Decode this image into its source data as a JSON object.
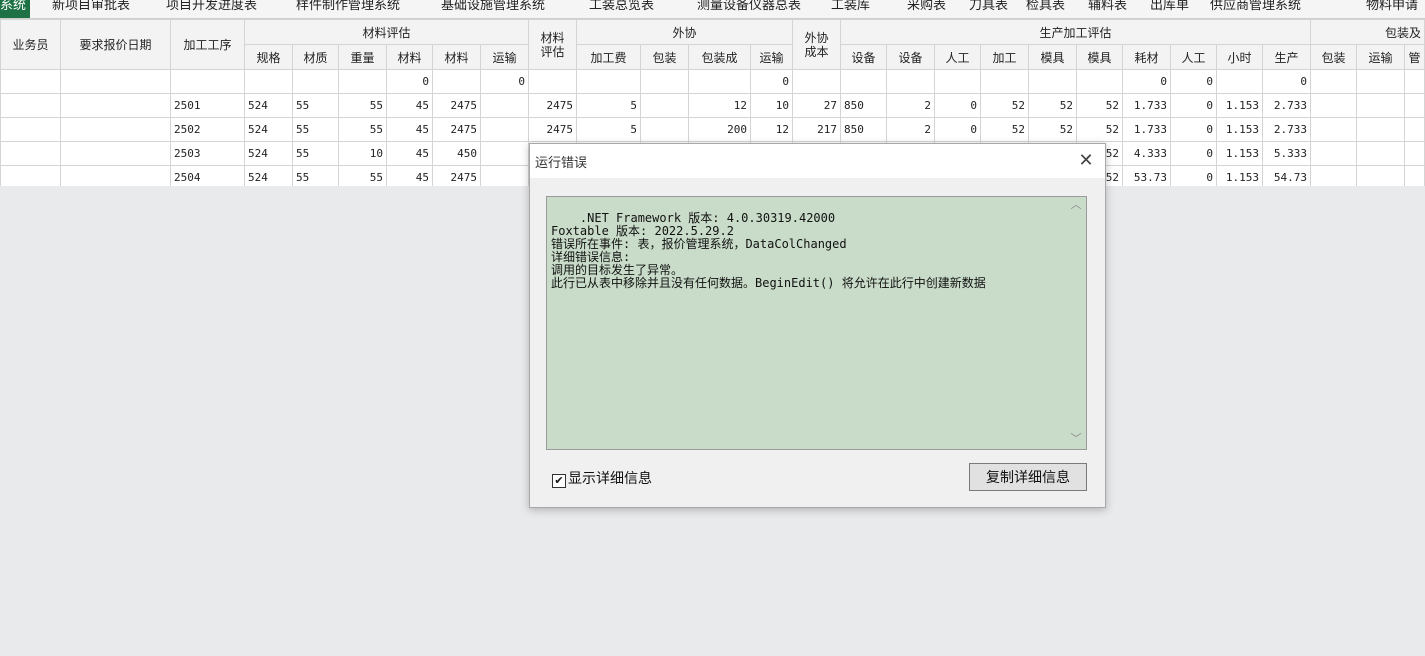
{
  "tabs": [
    "系统",
    "新项目审批表",
    "项目开发进度表",
    "样件制作管理系统",
    "基础设施管理系统",
    "工装总览表",
    "测量设备仪器总表",
    "工装库",
    "采购表",
    "刀具表",
    "检具表",
    "辅料表",
    "出库单",
    "供应商管理系统",
    "物料申请"
  ],
  "grid": {
    "header_top": {
      "salesman": "业务员",
      "quote_date": "要求报价日期",
      "process": "加工工序",
      "material_eval": "材料评估",
      "material_eval2": "材料\n评估",
      "outsource": "外协",
      "outsource_cost": "外协\n成本",
      "production_eval": "生产加工评估",
      "packaging": "包装及"
    },
    "header_sub": [
      "规格",
      "材质",
      "重量",
      "材料",
      "材料",
      "运输",
      "加工费",
      "包装",
      "包装成",
      "运输",
      "设备",
      "设备",
      "人工",
      "加工",
      "模具",
      "模具",
      "耗材",
      "人工",
      "小时",
      "生产",
      "包装",
      "运输",
      "管"
    ],
    "rows": [
      [
        "",
        "",
        "",
        "",
        "",
        "",
        "0",
        "",
        "0",
        "",
        "",
        "",
        "",
        "0",
        "",
        "",
        "",
        "",
        "",
        "",
        "",
        "0",
        "0",
        "",
        "0",
        "",
        "",
        ""
      ],
      [
        "",
        "",
        "2501",
        "524",
        "55",
        "55",
        "45",
        "2475",
        "",
        "2475",
        "5",
        "",
        "12",
        "10",
        "27",
        "850",
        "2",
        "0",
        "52",
        "52",
        "52",
        "1.733",
        "0",
        "1.153",
        "2.733",
        "",
        "",
        ""
      ],
      [
        "",
        "",
        "2502",
        "524",
        "55",
        "55",
        "45",
        "2475",
        "",
        "2475",
        "5",
        "",
        "200",
        "12",
        "217",
        "850",
        "2",
        "0",
        "52",
        "52",
        "52",
        "1.733",
        "0",
        "1.153",
        "2.733",
        "",
        "",
        ""
      ],
      [
        "",
        "",
        "2503",
        "524",
        "55",
        "10",
        "45",
        "450",
        "",
        "",
        "",
        "",
        "",
        "",
        "",
        "",
        "",
        "",
        "",
        "",
        "52",
        "4.333",
        "0",
        "1.153",
        "5.333",
        "",
        "",
        ""
      ],
      [
        "",
        "",
        "2504",
        "524",
        "55",
        "55",
        "45",
        "2475",
        "",
        "",
        "",
        "",
        "",
        "",
        "",
        "",
        "",
        "",
        "",
        "",
        "52",
        "53.73",
        "0",
        "1.153",
        "54.73",
        "",
        "",
        ""
      ]
    ]
  },
  "dialog": {
    "title": "运行错误",
    "message": ".NET Framework 版本: 4.0.30319.42000\nFoxtable 版本: 2022.5.29.2\n错误所在事件: 表，报价管理系统，DataColChanged\n详细错误信息:\n调用的目标发生了异常。\n此行已从表中移除并且没有任何数据。BeginEdit() 将允许在此行中创建新数据",
    "show_details_label": "显示详细信息",
    "show_details_checked": true,
    "copy_button": "复制详细信息"
  }
}
